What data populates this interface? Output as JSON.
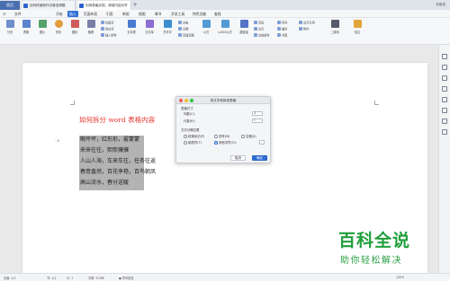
{
  "tabs": {
    "home": "首页",
    "doc1": "如何快速制作试卷选择题",
    "doc2": "利用表格实现，请填内容对齐"
  },
  "login": "未登录",
  "menu": [
    "文件",
    "开始",
    "插入",
    "页面布局",
    "引用",
    "审阅",
    "视图",
    "章节",
    "开发工具",
    "特色功能",
    "查找"
  ],
  "menu_active_index": 2,
  "ribbon": {
    "buttons": [
      "分页",
      "表格",
      "图片",
      "形状",
      "图标",
      "截屏",
      "文本框",
      "文字库",
      "艺术字",
      "公式",
      "LaTeX公式",
      "超链接",
      "二维码",
      "批注"
    ],
    "small_items": [
      "封面页",
      "空白页",
      "插入附件",
      "对象",
      "日期",
      "页眉页脚",
      "页码",
      "水印",
      "文档部件",
      "符号",
      "编号",
      "书签",
      "交叉引用",
      "附件"
    ]
  },
  "document": {
    "title": "如何拆分 word 表格内容",
    "lines": [
      "畹坪坪，红形形，雾蒙蒙",
      "来来往往，熙熙攘攘",
      "人山人海，车来车往，任务往返",
      "春意盎然，百花争艳，百鸟朝凤",
      "高山流水，春分送暖"
    ]
  },
  "dialog": {
    "title": "将文字转换成表格",
    "section_size": "表格尺寸",
    "cols_label": "列数(C):",
    "cols_value": "1",
    "rows_label": "行数(R):",
    "rows_value": "5",
    "section_sep": "文字分隔位置",
    "opt_para": "段落标记(P)",
    "opt_comma": "逗号(M)",
    "opt_space": "空格(S)",
    "opt_tab": "制表符(T)",
    "opt_other": "其他字符(O):",
    "selected_option": "其他字符(O):",
    "cancel": "取消",
    "ok": "确定"
  },
  "status": {
    "page": "页面: 1/1",
    "section": "节: 1/1",
    "row": "行: 1",
    "words": "字数: 57/86",
    "spell": "拼写检查",
    "zoom": "100%"
  },
  "watermark": {
    "title": "百科全说",
    "subtitle": "助你轻松解决"
  },
  "colors": {
    "accent": "#2f6fd6",
    "title_red": "#e4332b",
    "watermark_green": "#1f9f3a",
    "selection": "#b3b3b3"
  }
}
